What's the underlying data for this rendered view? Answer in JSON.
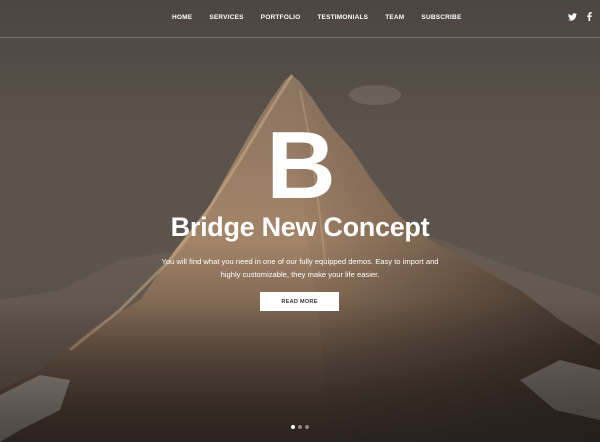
{
  "nav": {
    "items": [
      {
        "label": "HOME"
      },
      {
        "label": "SERVICES"
      },
      {
        "label": "PORTFOLIO"
      },
      {
        "label": "TESTIMONIALS"
      },
      {
        "label": "TEAM"
      },
      {
        "label": "SUBSCRIBE"
      }
    ],
    "social": [
      {
        "icon": "twitter-icon"
      },
      {
        "icon": "facebook-icon"
      }
    ]
  },
  "hero": {
    "logo_letter": "B",
    "title": "Bridge New Concept",
    "subtitle_line1": "You will find what you need in one of our fully equipped demos. Easy to import and",
    "subtitle_line2": "highly customizable, they make your life easier.",
    "cta_label": "READ MORE",
    "slides": [
      {
        "active": true
      },
      {
        "active": false
      },
      {
        "active": false
      }
    ]
  },
  "colors": {
    "sky": "#4c4540",
    "mountain_light": "#b59276",
    "mountain_dark": "#3a2f2a",
    "text": "#ffffff"
  }
}
